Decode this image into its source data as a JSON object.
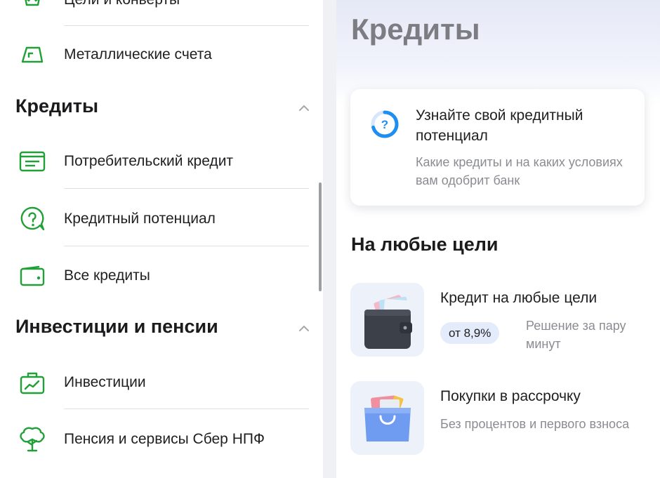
{
  "menu": {
    "items_top": [
      {
        "label": "Цели и конверты",
        "icon": "crown-target-icon"
      },
      {
        "label": "Металлические счета",
        "icon": "gold-bar-icon"
      }
    ],
    "sections": [
      {
        "title": "Кредиты",
        "items": [
          {
            "label": "Потребительский кредит",
            "icon": "document-card-icon"
          },
          {
            "label": "Кредитный потенциал",
            "icon": "question-bubble-icon"
          },
          {
            "label": "Все кредиты",
            "icon": "wallet-icon"
          }
        ]
      },
      {
        "title": "Инвестиции и пенсии",
        "items": [
          {
            "label": "Инвестиции",
            "icon": "briefcase-chart-icon"
          },
          {
            "label": "Пенсия и сервисы Сбер НПФ",
            "icon": "tree-icon"
          }
        ]
      }
    ]
  },
  "panel": {
    "title": "Кредиты",
    "promo_card": {
      "title": "Узнайте свой кредитный потенциал",
      "subtitle": "Какие кредиты и на каких условиях вам одобрит банк"
    },
    "section_title": "На любые цели",
    "products": [
      {
        "title": "Кредит на любые цели",
        "badge": "от 8,9%",
        "description": "Решение за пару минут",
        "icon": "wallet-cards-icon"
      },
      {
        "title": "Покупки в рассрочку",
        "description": "Без процентов и первого взноса",
        "icon": "shopping-bag-icon"
      }
    ]
  },
  "colors": {
    "accent_green": "#21a038",
    "accent_blue": "#1f8ef1",
    "badge_bg": "#e4ebfb"
  }
}
